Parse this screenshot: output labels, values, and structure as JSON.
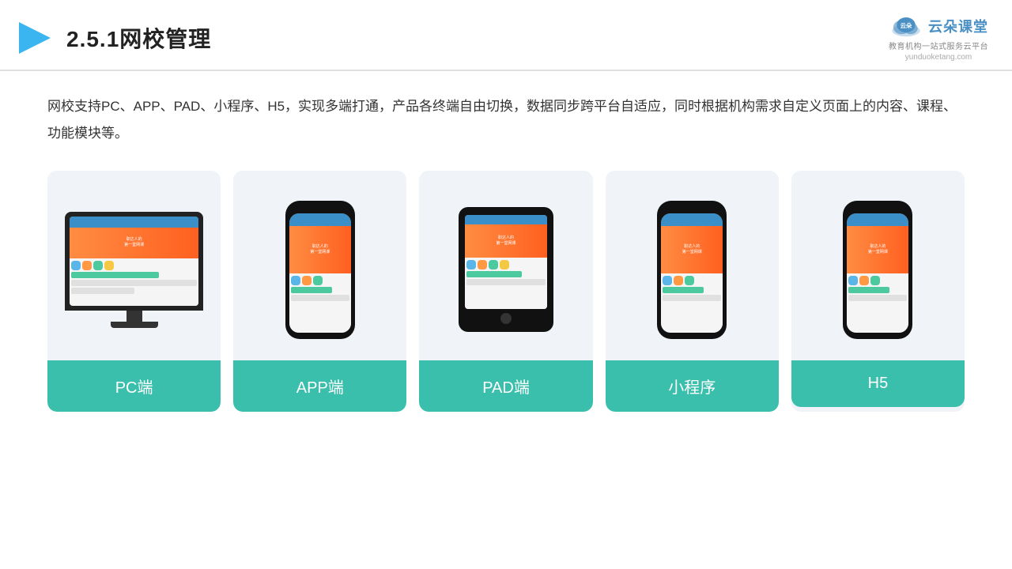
{
  "header": {
    "title": "2.5.1网校管理",
    "logo_text": "云朵课堂",
    "logo_sub": "教育机构一站式服务云平台",
    "logo_url": "yunduoketang.com"
  },
  "description": "网校支持PC、APP、PAD、小程序、H5，实现多端打通，产品各终端自由切换，数据同步跨平台自适应，同时根据机构需求自定义页面上的内容、课程、功能模块等。",
  "cards": [
    {
      "id": "pc",
      "label": "PC端"
    },
    {
      "id": "app",
      "label": "APP端"
    },
    {
      "id": "pad",
      "label": "PAD端"
    },
    {
      "id": "miniapp",
      "label": "小程序"
    },
    {
      "id": "h5",
      "label": "H5"
    }
  ]
}
